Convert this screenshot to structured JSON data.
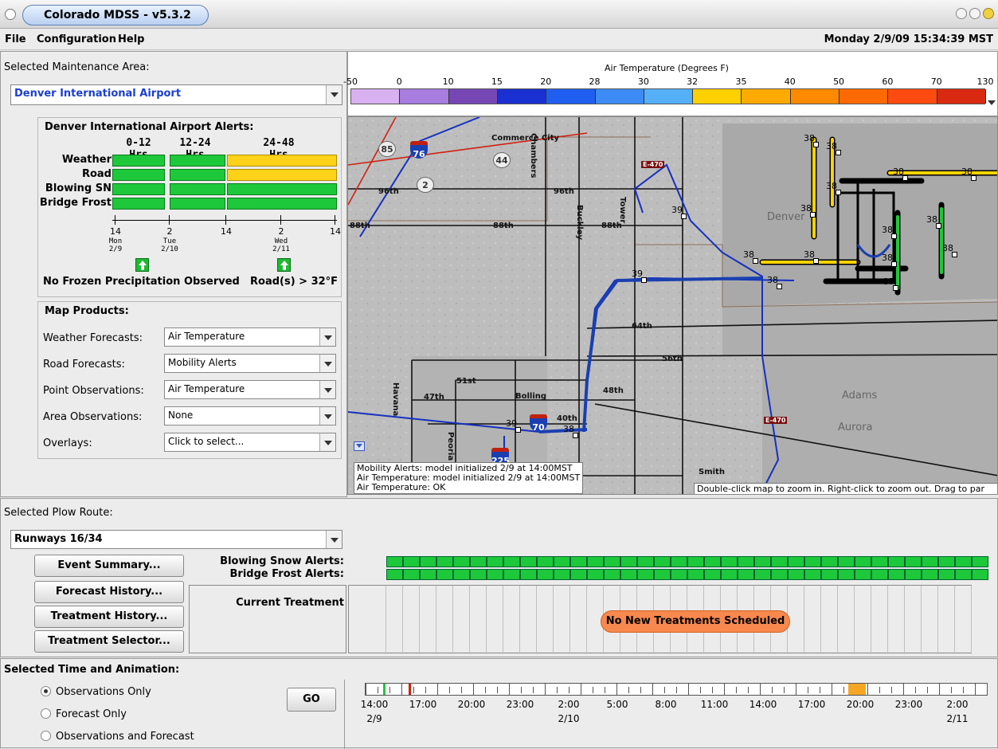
{
  "window": {
    "title": "Colorado MDSS - v5.3.2"
  },
  "menu": {
    "items": [
      "File",
      "Configuration",
      "Help"
    ],
    "datetime": "Monday 2/9/09 15:34:39 MST"
  },
  "maintenance": {
    "label": "Selected Maintenance Area:",
    "value": "Denver International Airport",
    "alerts_title": "Denver International Airport Alerts:",
    "periods": [
      "0-12",
      "12-24",
      "24-48"
    ],
    "hrs": "Hrs",
    "rows": [
      {
        "label": "Weather",
        "colors": [
          "green",
          "green",
          "yellow"
        ]
      },
      {
        "label": "Road",
        "colors": [
          "green",
          "green",
          "yellow"
        ]
      },
      {
        "label": "Blowing SN",
        "colors": [
          "green",
          "green",
          "green"
        ]
      },
      {
        "label": "Bridge Frost",
        "colors": [
          "green",
          "green",
          "green"
        ]
      }
    ],
    "axis_ticks": [
      {
        "hour": "14",
        "day": "Mon",
        "date": "2/9"
      },
      {
        "hour": "2",
        "day": "Tue",
        "date": "2/10"
      },
      {
        "hour": "14",
        "day": "",
        "date": ""
      },
      {
        "hour": "2",
        "day": "Wed",
        "date": "2/11"
      },
      {
        "hour": "14",
        "day": "",
        "date": ""
      }
    ],
    "precip_status": "No Frozen Precipitation Observed",
    "road_status": "Road(s) > 32°F"
  },
  "map_products": {
    "title": "Map Products:",
    "rows": [
      {
        "label": "Weather Forecasts:",
        "value": "Air Temperature"
      },
      {
        "label": "Road Forecasts:",
        "value": "Mobility Alerts"
      },
      {
        "label": "Point Observations:",
        "value": "Air Temperature"
      },
      {
        "label": "Area Observations:",
        "value": "None"
      },
      {
        "label": "Overlays:",
        "value": "Click to select..."
      }
    ]
  },
  "legend": {
    "title": "Air Temperature (Degrees F)",
    "ticks": [
      "-50",
      "0",
      "10",
      "15",
      "20",
      "28",
      "30",
      "32",
      "35",
      "40",
      "50",
      "60",
      "70",
      "130"
    ],
    "colors": [
      "#d9b0f0",
      "#a77de0",
      "#7646b5",
      "#1a30d0",
      "#1f5ff0",
      "#3d8cf5",
      "#55b0f8",
      "#ffd000",
      "#ffaa00",
      "#ff8a00",
      "#ff6a00",
      "#ff4a10",
      "#d82a10"
    ]
  },
  "map": {
    "place_labels": [
      "Commerce City",
      "96th",
      "96th",
      "88th",
      "88th",
      "88th",
      "64th",
      "56th",
      "51st",
      "48th",
      "47th",
      "40th",
      "Havana",
      "Tower",
      "Buckley",
      "Chambers",
      "Peoria",
      "Bolling",
      "Smith",
      "Adams",
      "Aurora",
      "Denver",
      "E-470",
      "E-470"
    ],
    "highway_shields": [
      "85",
      "76",
      "44",
      "2",
      "70",
      "225"
    ],
    "temp_points": [
      "38",
      "38",
      "38",
      "38",
      "38",
      "38",
      "38",
      "38",
      "38",
      "38",
      "38",
      "38",
      "38",
      "37",
      "39",
      "39",
      "39",
      "38"
    ],
    "status_lines": [
      "Mobility Alerts: model initialized 2/9 at 14:00MST",
      "Air Temperature: model initialized 2/9 at 14:00MST",
      "Air Temperature: OK"
    ],
    "hint": "Double-click map to zoom in. Right-click to zoom out. Drag to par"
  },
  "plow": {
    "label": "Selected Plow Route:",
    "value": "Runways 16/34",
    "buttons": [
      "Event Summary...",
      "Forecast History...",
      "Treatment History...",
      "Treatment Selector..."
    ],
    "blowing_label": "Blowing Snow Alerts:",
    "bridge_label": "Bridge Frost Alerts:",
    "current_label": "Current Treatment",
    "no_treatments": "No New Treatments Scheduled",
    "alert_segments": 36,
    "alert_color": "#1dc83a"
  },
  "animation": {
    "label": "Selected Time and Animation:",
    "options": [
      {
        "label": "Observations Only",
        "selected": true
      },
      {
        "label": "Forecast Only",
        "selected": false
      },
      {
        "label": "Observations and Forecast",
        "selected": false
      }
    ],
    "go": "GO",
    "times": [
      "14:00",
      "17:00",
      "20:00",
      "23:00",
      "2:00",
      "5:00",
      "8:00",
      "11:00",
      "14:00",
      "17:00",
      "20:00",
      "23:00",
      "2:00"
    ],
    "dates": [
      {
        "index": 0,
        "date": "2/9"
      },
      {
        "index": 4,
        "date": "2/10"
      },
      {
        "index": 12,
        "date": "2/11"
      }
    ]
  }
}
